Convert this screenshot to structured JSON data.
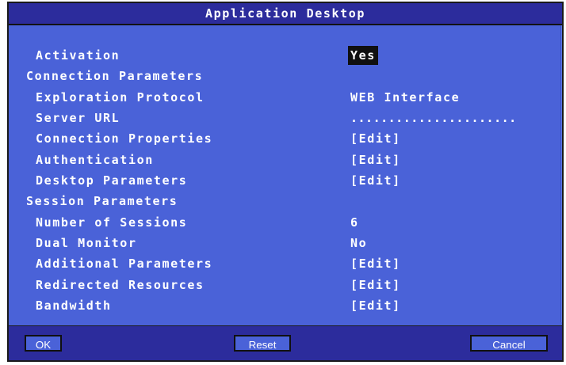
{
  "title": "Application Desktop",
  "colors": {
    "dialog_bg": "#4a62d8",
    "title_bg": "#2c2c9c",
    "text": "#ffffff",
    "selection_bg": "#101010"
  },
  "rows": {
    "activation": {
      "label": "Activation",
      "value": "Yes"
    },
    "connection_section": "Connection Parameters",
    "exploration_protocol": {
      "label": "Exploration Protocol",
      "value": "WEB Interface"
    },
    "server_url": {
      "label": "Server URL",
      "value": "......................"
    },
    "connection_properties": {
      "label": "Connection Properties",
      "value": "[Edit]"
    },
    "authentication": {
      "label": "Authentication",
      "value": "[Edit]"
    },
    "desktop_parameters": {
      "label": "Desktop Parameters",
      "value": "[Edit]"
    },
    "session_section": "Session Parameters",
    "number_of_sessions": {
      "label": "Number of Sessions",
      "value": "6"
    },
    "dual_monitor": {
      "label": "Dual Monitor",
      "value": "No"
    },
    "additional_parameters": {
      "label": "Additional Parameters",
      "value": "[Edit]"
    },
    "redirected_resources": {
      "label": "Redirected Resources",
      "value": "[Edit]"
    },
    "bandwidth": {
      "label": "Bandwidth",
      "value": "[Edit]"
    }
  },
  "buttons": {
    "ok": "OK",
    "reset": "Reset",
    "cancel": "Cancel"
  }
}
